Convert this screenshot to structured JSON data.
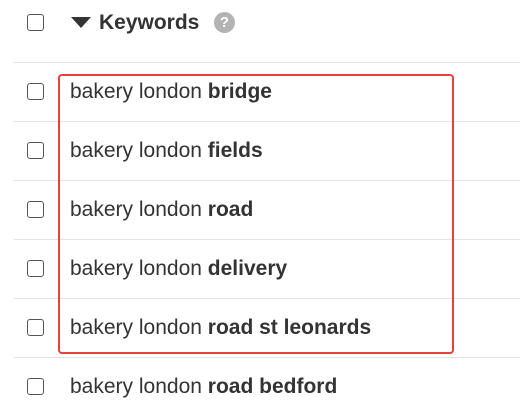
{
  "header": {
    "label": "Keywords",
    "help_glyph": "?",
    "sort_icon": "sort-desc-icon"
  },
  "keywords": [
    {
      "base": "bakery london",
      "suffix": "bridge"
    },
    {
      "base": "bakery london",
      "suffix": "fields"
    },
    {
      "base": "bakery london",
      "suffix": "road"
    },
    {
      "base": "bakery london",
      "suffix": "delivery"
    },
    {
      "base": "bakery london",
      "suffix": "road st leonards"
    },
    {
      "base": "bakery london",
      "suffix": "road bedford"
    }
  ],
  "colors": {
    "highlight_border": "#e8403a",
    "text": "#333333",
    "divider": "#e3e3e3",
    "help_icon_bg": "#b3b3b3"
  }
}
